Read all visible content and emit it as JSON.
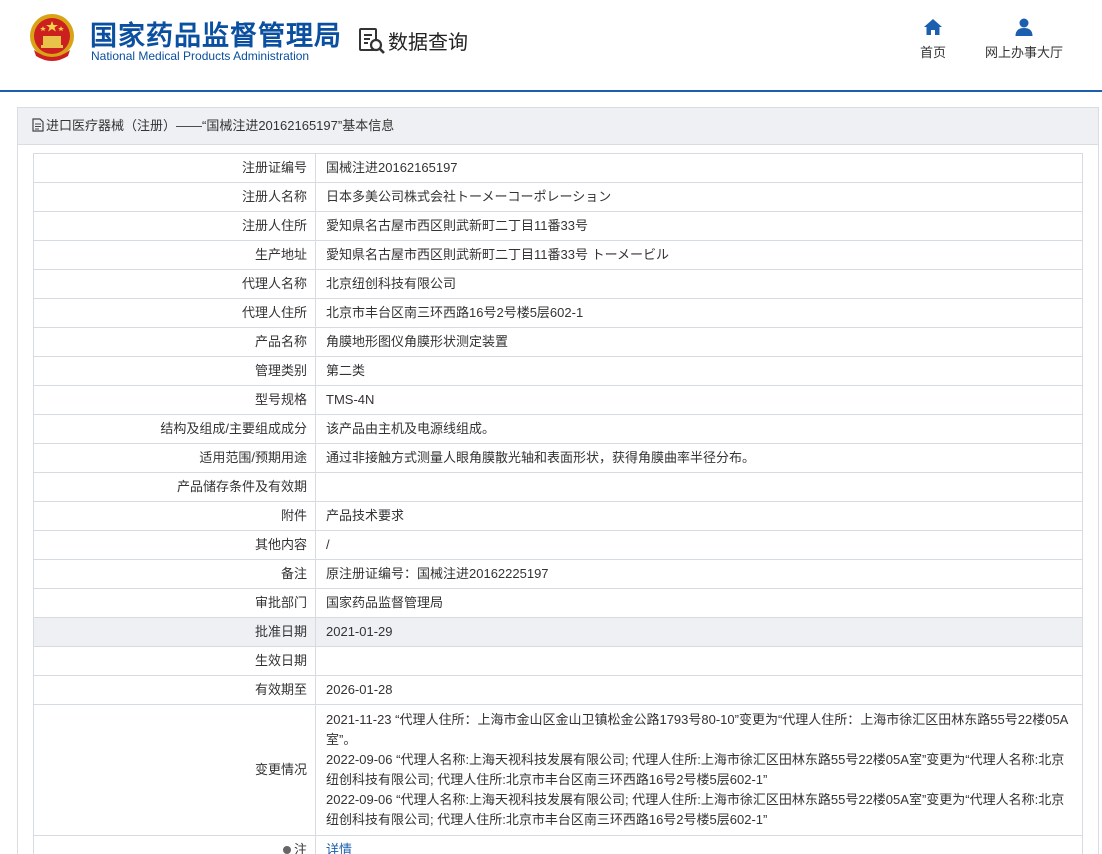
{
  "header": {
    "brand_cn": "国家药品监督管理局",
    "brand_en": "National Medical Products Administration",
    "query_title": "数据查询",
    "nav": {
      "home": "首页",
      "hall": "网上办事大厅"
    }
  },
  "panel": {
    "title": "进口医疗器械（注册）——“国械注进20162165197”基本信息"
  },
  "rows": [
    {
      "label": "注册证编号",
      "value": "国械注进20162165197"
    },
    {
      "label": "注册人名称",
      "value": "日本多美公司株式会社トーメーコーポレーション"
    },
    {
      "label": "注册人住所",
      "value": "愛知県名古屋市西区則武新町二丁目11番33号"
    },
    {
      "label": "生产地址",
      "value": "愛知県名古屋市西区則武新町二丁目11番33号 トーメービル"
    },
    {
      "label": "代理人名称",
      "value": "北京纽创科技有限公司"
    },
    {
      "label": "代理人住所",
      "value": "北京市丰台区南三环西路16号2号楼5层602-1"
    },
    {
      "label": "产品名称",
      "value": "角膜地形图仪角膜形状测定装置"
    },
    {
      "label": "管理类别",
      "value": "第二类"
    },
    {
      "label": "型号规格",
      "value": "TMS-4N"
    },
    {
      "label": "结构及组成/主要组成成分",
      "value": "该产品由主机及电源线组成。"
    },
    {
      "label": "适用范围/预期用途",
      "value": "通过非接触方式测量人眼角膜散光轴和表面形状，获得角膜曲率半径分布。"
    },
    {
      "label": "产品储存条件及有效期",
      "value": ""
    },
    {
      "label": "附件",
      "value": "产品技术要求"
    },
    {
      "label": "其他内容",
      "value": "/"
    },
    {
      "label": "备注",
      "value": "原注册证编号：国械注进20162225197"
    },
    {
      "label": "审批部门",
      "value": "国家药品监督管理局"
    },
    {
      "label": "批准日期",
      "value": "2021-01-29"
    },
    {
      "label": "生效日期",
      "value": ""
    },
    {
      "label": "有效期至",
      "value": "2026-01-28"
    }
  ],
  "changes": {
    "label": "变更情况",
    "lines": [
      "2021-11-23 “代理人住所：上海市金山区金山卫镇松金公路1793号80-10”变更为“代理人住所：上海市徐汇区田林东路55号22楼05A室”。",
      "2022-09-06 “代理人名称:上海天视科技发展有限公司; 代理人住所:上海市徐汇区田林东路55号22楼05A室”变更为“代理人名称:北京纽创科技有限公司; 代理人住所:北京市丰台区南三环西路16号2号楼5层602-1”",
      "2022-09-06 “代理人名称:上海天视科技发展有限公司; 代理人住所:上海市徐汇区田林东路55号22楼05A室”变更为“代理人名称:北京纽创科技有限公司; 代理人住所:北京市丰台区南三环西路16号2号楼5层602-1”"
    ]
  },
  "note": {
    "label": "注",
    "link": "详情"
  },
  "colors": {
    "brand": "#0a4fa0",
    "accent": "#1c5fae",
    "row_alt": "#eef0f4"
  },
  "icons": {
    "emblem": "national-emblem-icon",
    "query": "document-search-icon",
    "home": "home-icon",
    "hall": "user-icon",
    "doc": "document-icon"
  }
}
